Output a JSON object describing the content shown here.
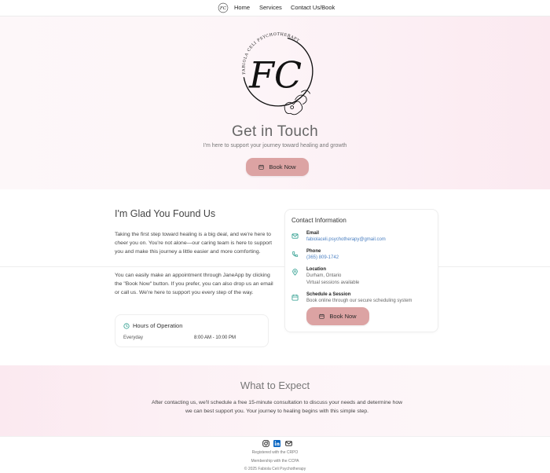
{
  "nav": {
    "logo_text": "FC",
    "items": [
      {
        "label": "Home"
      },
      {
        "label": "Services"
      },
      {
        "label": "Contact Us/Book"
      }
    ]
  },
  "hero": {
    "emblem_monogram": "FC",
    "emblem_arc_text": "FABIOLA CELI PSYCHOTHERAPY",
    "title": "Get in Touch",
    "subtitle": "I'm here to support your journey toward healing and growth",
    "book_label": "Book Now"
  },
  "intro": {
    "title": "I'm Glad You Found Us",
    "paragraph1": "Taking the first step toward healing is a big deal, and we're here to cheer you on. You're not alone—our caring team is here to support you and make this journey a little easier and more comforting.",
    "paragraph2": "You can easily make an appointment through JaneApp by clicking the \"Book Now\" button. If you prefer, you can also drop us an email or call us. We're here to support you every step of the way."
  },
  "hours": {
    "title": "Hours of Operation",
    "day": "Everyday",
    "time": "8:00 AM - 10:00 PM"
  },
  "contact": {
    "title": "Contact Information",
    "email_label": "Email",
    "email_value": "fabiolaceli.psychotherapy@gmail.com",
    "phone_label": "Phone",
    "phone_value": "(365) 809-1742",
    "location_label": "Location",
    "location_value": "Durham, Ontario",
    "location_note": "Virtual sessions available",
    "schedule_label": "Schedule a Session",
    "schedule_note": "Book online through our secure scheduling system",
    "book_label": "Book Now"
  },
  "expect": {
    "title": "What to Expect",
    "text": "After contacting us, we'll schedule a free 15-minute consultation to discuss your needs and determine how we can best support you. Your journey to healing begins with this simple step."
  },
  "footer": {
    "line1": "Registered with the CRPO",
    "line2": "Membership with the CCPA",
    "line3": "© 2025 Fabiola Celi Psychotherapy",
    "social": [
      "instagram-icon",
      "linkedin-icon",
      "mail-icon"
    ]
  },
  "colors": {
    "button": "#dca3a3",
    "accent_icon": "#2f9e8f",
    "link": "#4a7fc1"
  }
}
